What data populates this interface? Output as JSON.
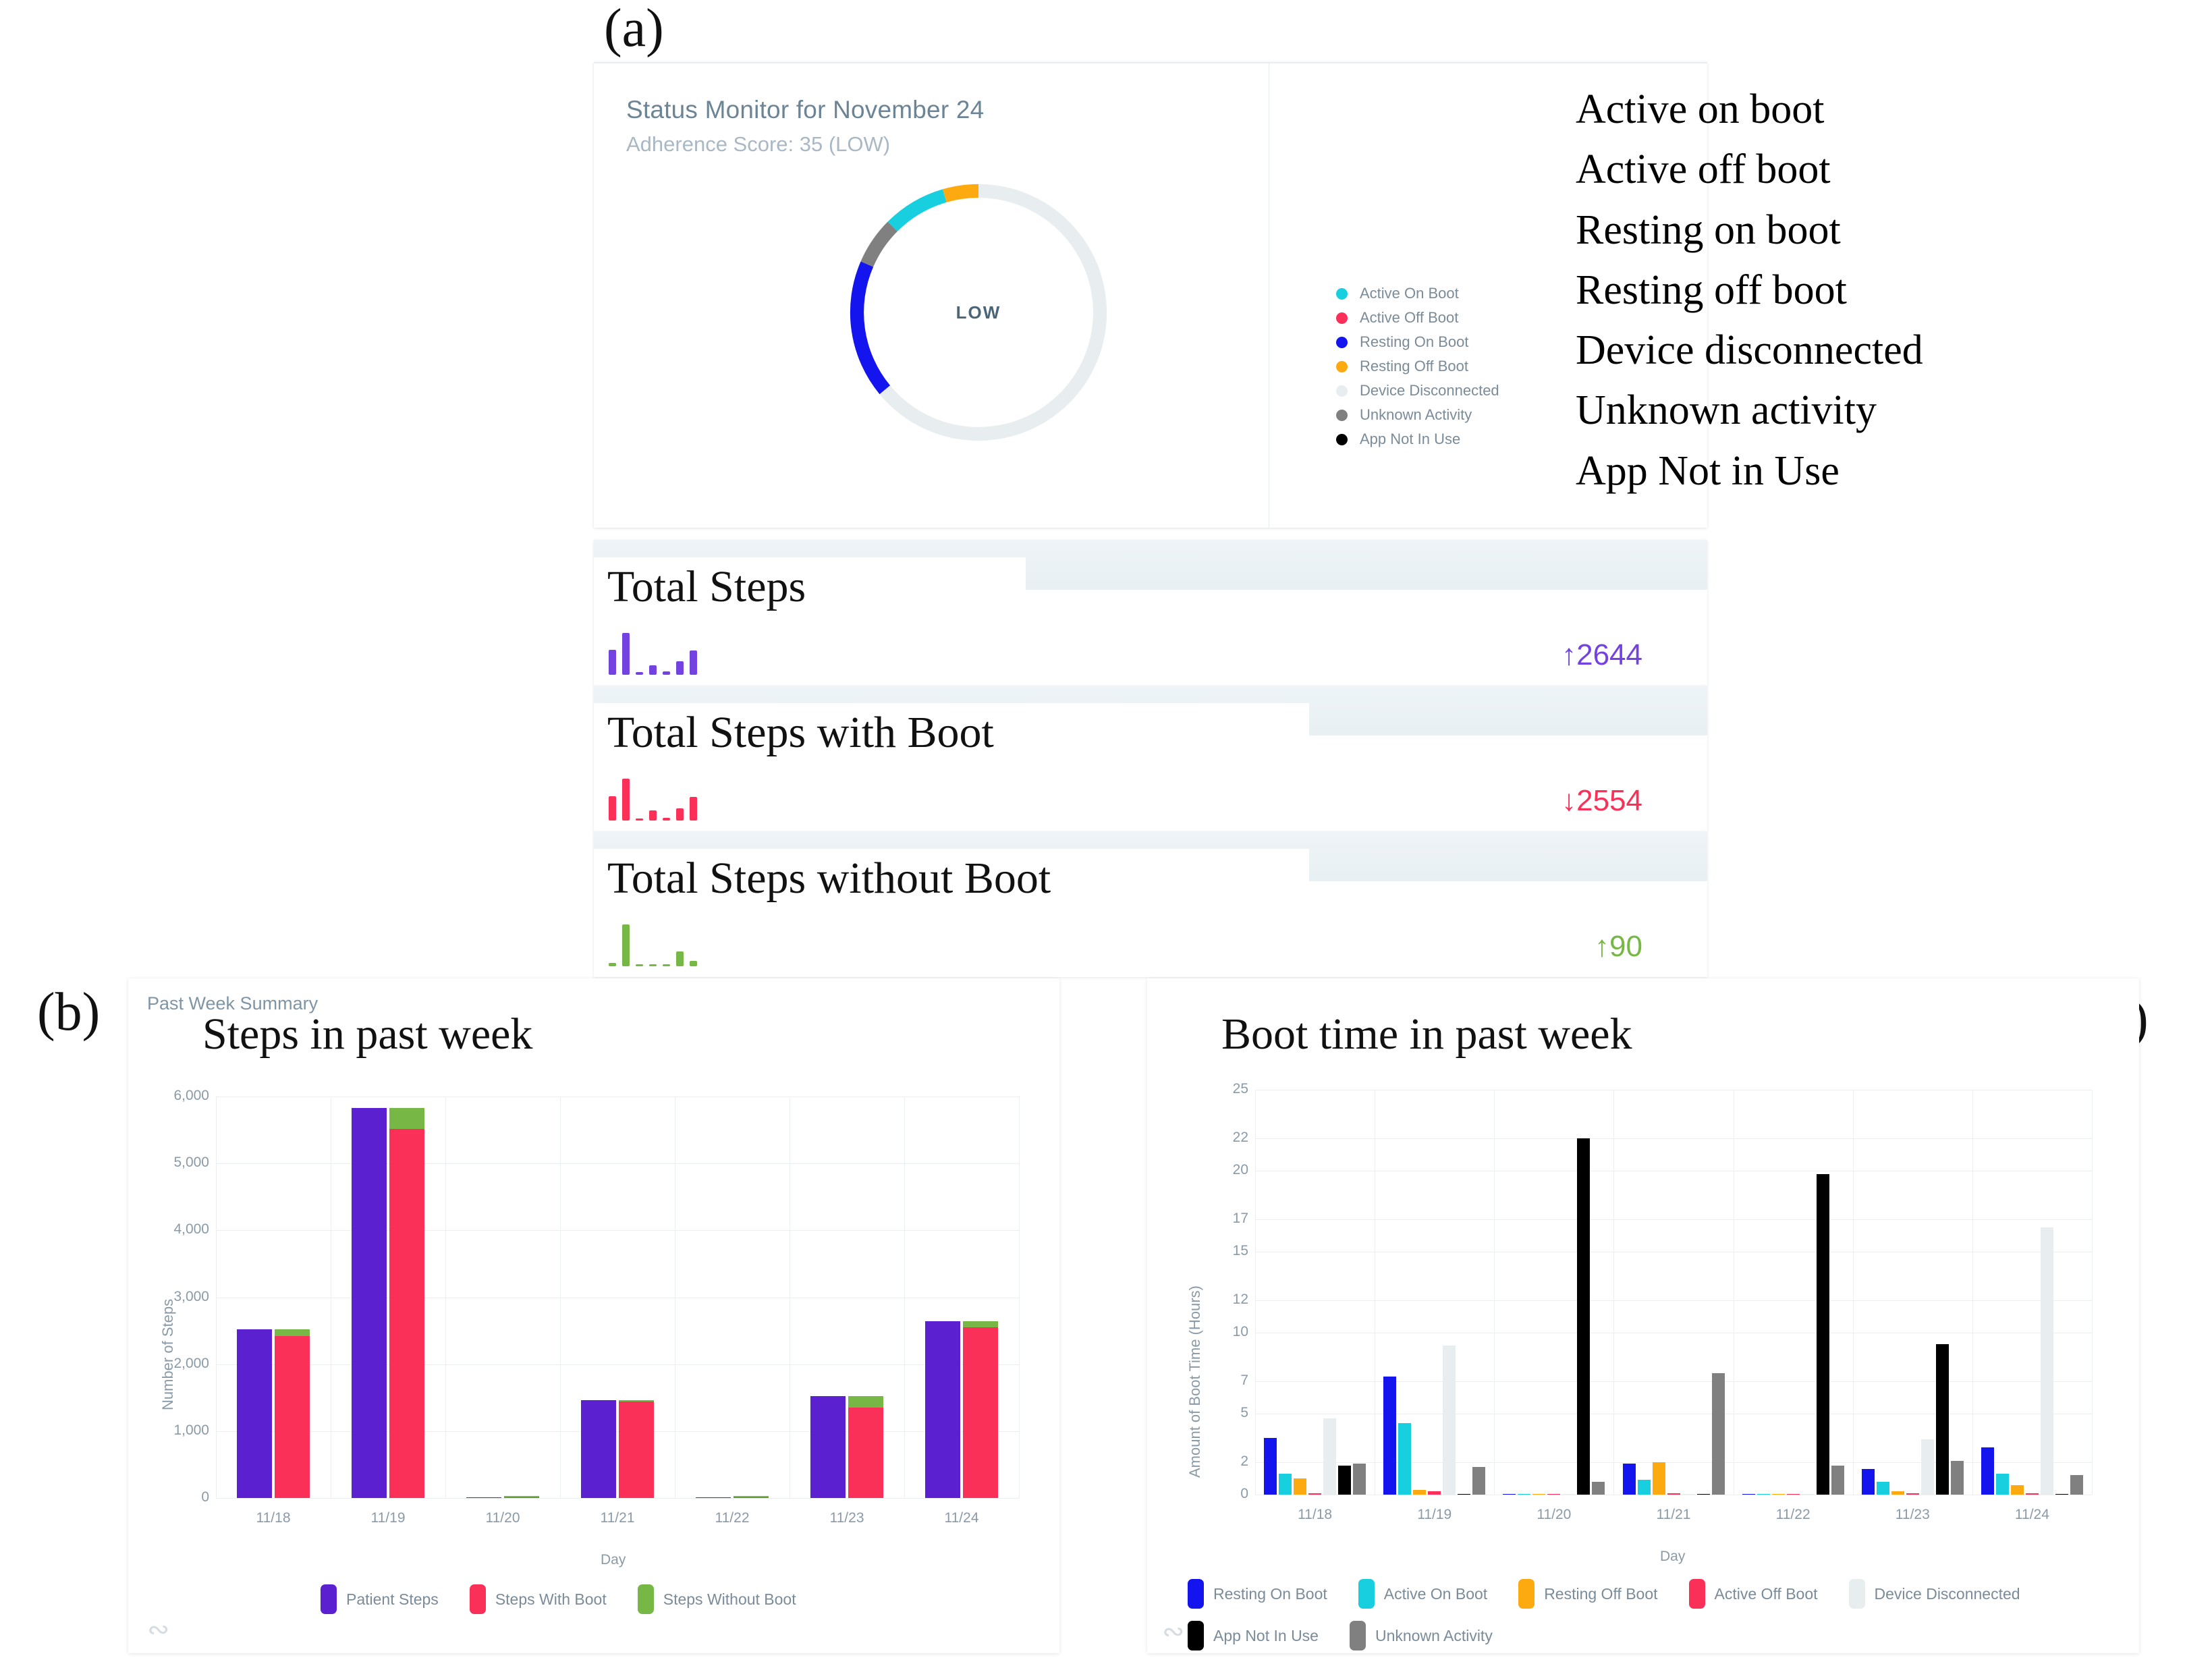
{
  "panel_letters": {
    "a": "(a)",
    "b": "(b)",
    "c": "(c)"
  },
  "status_card": {
    "title": "Status Monitor for November 24",
    "subtitle": "Adherence Score: 35 (LOW)",
    "donut_center_label": "LOW",
    "legend": [
      {
        "label": "Active On Boot",
        "color": "#18cfe0"
      },
      {
        "label": "Active Off Boot",
        "color": "#fb3058"
      },
      {
        "label": "Resting On Boot",
        "color": "#1414ef"
      },
      {
        "label": "Resting Off Boot",
        "color": "#fdaa11"
      },
      {
        "label": "Device Disconnected",
        "color": "#e8edf0"
      },
      {
        "label": "Unknown Activity",
        "color": "#808080"
      },
      {
        "label": "App Not In Use",
        "color": "#000000"
      }
    ],
    "donut_segments": [
      {
        "name": "Resting Off Boot",
        "color": "#fdaa11",
        "percent": 4.5
      },
      {
        "name": "Active On Boot",
        "color": "#18cfe0",
        "percent": 8.0
      },
      {
        "name": "Unknown Activity",
        "color": "#808080",
        "percent": 6.0
      },
      {
        "name": "Resting On Boot",
        "color": "#1414ef",
        "percent": 17.5
      },
      {
        "name": "Device Disconnected",
        "color": "#e8edf0",
        "percent": 64.0
      }
    ]
  },
  "annotations": [
    "Active on boot",
    "Active off boot",
    "Resting on boot",
    "Resting off boot",
    "Device disconnected",
    "Unknown activity",
    "App Not in Use"
  ],
  "metrics": [
    {
      "title": "Total Steps",
      "value": "↑2644",
      "color": "#7442e0",
      "spark": [
        28,
        47,
        3,
        11,
        4,
        15,
        27
      ]
    },
    {
      "title": "Total Steps with Boot",
      "value": "↓2554",
      "color": "#fb3058",
      "spark": [
        27,
        46,
        2,
        11,
        3,
        13,
        26
      ]
    },
    {
      "title": "Total Steps without Boot",
      "value": "↑90",
      "color": "#77b745",
      "spark": [
        3,
        40,
        1,
        2,
        1,
        14,
        5
      ]
    }
  ],
  "past_week_summary_label": "Past Week Summary",
  "chart_data": [
    {
      "id": "steps-chart",
      "type": "bar",
      "title": "Steps in past week",
      "xlabel": "Day",
      "ylabel": "Number of Steps",
      "ylim": [
        0,
        6000
      ],
      "yticks": [
        0,
        1000,
        2000,
        3000,
        4000,
        5000,
        6000
      ],
      "ytick_labels": [
        "0",
        "1,000",
        "2,000",
        "3,000",
        "4,000",
        "5,000",
        "6,000"
      ],
      "grid": true,
      "legend_position": "bottom",
      "categories": [
        "11/18",
        "11/19",
        "11/20",
        "11/21",
        "11/22",
        "11/23",
        "11/24"
      ],
      "series": [
        {
          "name": "Patient Steps",
          "color": "#5b21d0",
          "values": [
            2520,
            5830,
            10,
            1460,
            10,
            1520,
            2640
          ]
        },
        {
          "name": "Steps With Boot",
          "color": "#fb3058",
          "values": [
            2420,
            5520,
            5,
            1440,
            5,
            1350,
            2550
          ]
        },
        {
          "name": "Steps Without Boot",
          "color": "#77b745",
          "values": [
            100,
            310,
            5,
            20,
            5,
            170,
            90
          ],
          "stacked_on": "Steps With Boot"
        }
      ]
    },
    {
      "id": "boot-time-chart",
      "type": "bar",
      "title": "Boot time in past week",
      "xlabel": "Day",
      "ylabel": "Amount of Boot Time (Hours)",
      "ylim": [
        0,
        25
      ],
      "yticks": [
        0,
        2,
        5,
        7,
        10,
        12,
        15,
        17,
        20,
        22,
        25
      ],
      "ytick_labels": [
        "0",
        "2",
        "5",
        "7",
        "10",
        "12",
        "15",
        "17",
        "20",
        "22",
        "25"
      ],
      "grid": true,
      "legend_position": "bottom",
      "categories": [
        "11/18",
        "11/19",
        "11/20",
        "11/21",
        "11/22",
        "11/23",
        "11/24"
      ],
      "series": [
        {
          "name": "Resting On Boot",
          "color": "#1414ef",
          "values": [
            3.5,
            7.3,
            0.05,
            1.9,
            0.05,
            1.6,
            2.9
          ]
        },
        {
          "name": "Active On Boot",
          "color": "#18cfe0",
          "values": [
            1.3,
            4.4,
            0.05,
            0.9,
            0.05,
            0.8,
            1.3
          ]
        },
        {
          "name": "Resting Off Boot",
          "color": "#fdaa11",
          "values": [
            1.0,
            0.3,
            0.03,
            2.0,
            0.03,
            0.2,
            0.6
          ]
        },
        {
          "name": "Active Off Boot",
          "color": "#fb3058",
          "values": [
            0.1,
            0.2,
            0.03,
            0.1,
            0.03,
            0.1,
            0.1
          ]
        },
        {
          "name": "Device Disconnected",
          "color": "#e8edf0",
          "values": [
            4.7,
            9.2,
            0.02,
            0.05,
            0.02,
            3.4,
            16.5
          ]
        },
        {
          "name": "App Not In Use",
          "color": "#000000",
          "values": [
            1.8,
            0.05,
            22.0,
            0.02,
            19.8,
            9.3,
            0.02
          ]
        },
        {
          "name": "Unknown Activity",
          "color": "#808080",
          "values": [
            1.9,
            1.7,
            0.8,
            7.5,
            1.8,
            2.1,
            1.2
          ]
        }
      ]
    }
  ]
}
